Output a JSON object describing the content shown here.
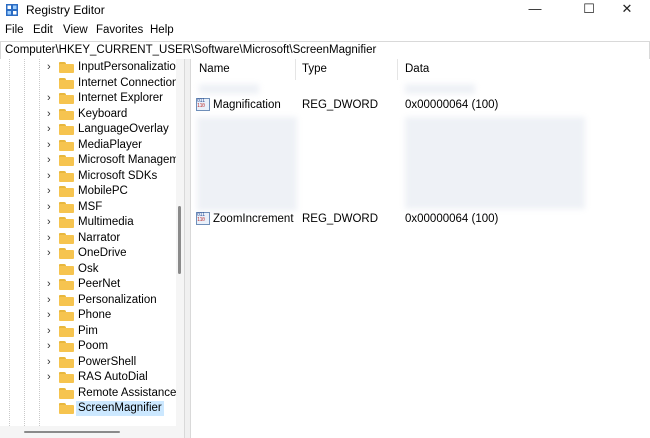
{
  "window": {
    "title": "Registry Editor",
    "app_icon": "registry-editor-icon",
    "minimize_glyph": "—",
    "maximize_glyph": "☐",
    "close_glyph": "✕"
  },
  "menu": [
    "File",
    "Edit",
    "View",
    "Favorites",
    "Help"
  ],
  "address": "Computer\\HKEY_CURRENT_USER\\Software\\Microsoft\\ScreenMagnifier",
  "tree": {
    "items": [
      {
        "label": "InputPersonalization",
        "expandable": true,
        "selected": false
      },
      {
        "label": "Internet Connection",
        "expandable": false,
        "selected": false
      },
      {
        "label": "Internet Explorer",
        "expandable": true,
        "selected": false
      },
      {
        "label": "Keyboard",
        "expandable": true,
        "selected": false
      },
      {
        "label": "LanguageOverlay",
        "expandable": true,
        "selected": false
      },
      {
        "label": "MediaPlayer",
        "expandable": true,
        "selected": false
      },
      {
        "label": "Microsoft Managem",
        "expandable": true,
        "selected": false
      },
      {
        "label": "Microsoft SDKs",
        "expandable": true,
        "selected": false
      },
      {
        "label": "MobilePC",
        "expandable": true,
        "selected": false
      },
      {
        "label": "MSF",
        "expandable": true,
        "selected": false
      },
      {
        "label": "Multimedia",
        "expandable": true,
        "selected": false
      },
      {
        "label": "Narrator",
        "expandable": true,
        "selected": false
      },
      {
        "label": "OneDrive",
        "expandable": true,
        "selected": false
      },
      {
        "label": "Osk",
        "expandable": false,
        "selected": false
      },
      {
        "label": "PeerNet",
        "expandable": true,
        "selected": false
      },
      {
        "label": "Personalization",
        "expandable": true,
        "selected": false
      },
      {
        "label": "Phone",
        "expandable": true,
        "selected": false
      },
      {
        "label": "Pim",
        "expandable": true,
        "selected": false
      },
      {
        "label": "Poom",
        "expandable": true,
        "selected": false
      },
      {
        "label": "PowerShell",
        "expandable": true,
        "selected": false
      },
      {
        "label": "RAS AutoDial",
        "expandable": true,
        "selected": false
      },
      {
        "label": "Remote Assistance",
        "expandable": false,
        "selected": false
      },
      {
        "label": "ScreenMagnifier",
        "expandable": false,
        "selected": true
      }
    ]
  },
  "list": {
    "columns": [
      "Name",
      "Type",
      "Data"
    ],
    "rows": [
      {
        "name": "Magnification",
        "type": "REG_DWORD",
        "data": "0x00000064 (100)"
      },
      {
        "name": "ZoomIncrement",
        "type": "REG_DWORD",
        "data": "0x00000064 (100)"
      }
    ]
  },
  "colors": {
    "selection": "#cce8ff",
    "folder": "#f6c44f",
    "border": "#d9d9d9"
  }
}
